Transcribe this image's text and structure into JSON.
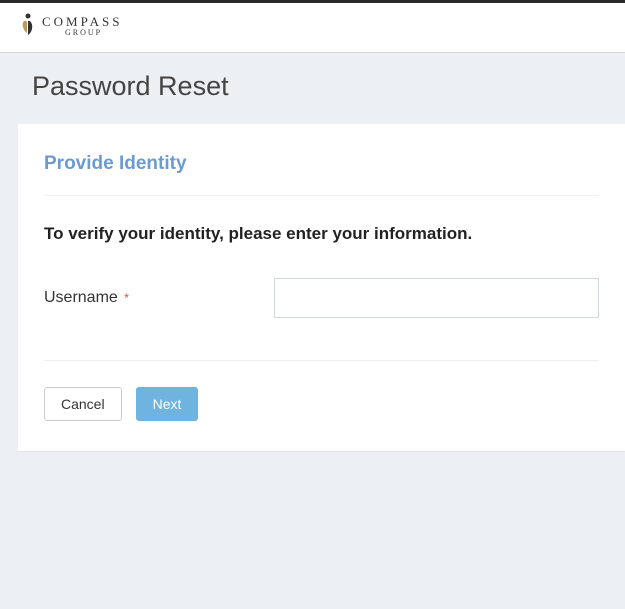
{
  "brand": {
    "name": "COMPASS",
    "sub": "GROUP"
  },
  "page": {
    "title": "Password Reset"
  },
  "card": {
    "title": "Provide Identity",
    "instruction": "To verify your identity, please enter your information.",
    "form": {
      "username_label": "Username",
      "required_mark": "*",
      "username_value": ""
    },
    "buttons": {
      "cancel": "Cancel",
      "next": "Next"
    }
  }
}
